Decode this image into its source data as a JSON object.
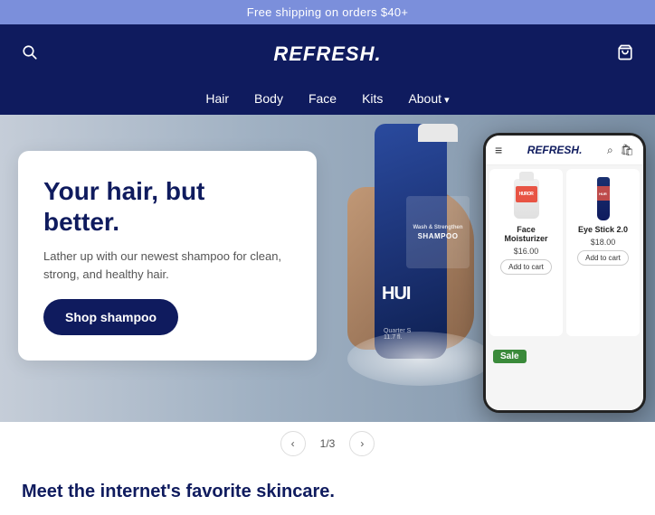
{
  "announcement": {
    "text": "Free shipping on orders $40+"
  },
  "header": {
    "logo": "REFRESH.",
    "search_icon": "⌕",
    "cart_icon": "🛍"
  },
  "nav": {
    "items": [
      {
        "label": "Hair",
        "has_arrow": false
      },
      {
        "label": "Body",
        "has_arrow": false
      },
      {
        "label": "Face",
        "has_arrow": false
      },
      {
        "label": "Kits",
        "has_arrow": false
      },
      {
        "label": "About",
        "has_arrow": true
      }
    ]
  },
  "hero": {
    "headline": "Your hair, but better.",
    "subtext": "Lather up with our newest shampoo for clean, strong, and healthy hair.",
    "cta_label": "Shop shampoo",
    "bottle_text": "HUI",
    "bottle_sublabel": "Wash & Strengthen",
    "bottle_sublabel2": "SHAMPOO",
    "bottle_size": "Quarter S",
    "bottle_size2": "11.7 fl."
  },
  "phone": {
    "logo": "REFRESH.",
    "products": [
      {
        "name": "Face Moisturizer",
        "price": "$16.00",
        "add_label": "Add to cart"
      },
      {
        "name": "Eye Stick 2.0",
        "price": "$18.00",
        "add_label": "Add to cart"
      }
    ]
  },
  "slider": {
    "prev": "‹",
    "next": "›",
    "indicator": "1/3"
  },
  "bottom": {
    "heading": "Meet the internet's favorite skincare.",
    "sale_badge": "Sale"
  }
}
